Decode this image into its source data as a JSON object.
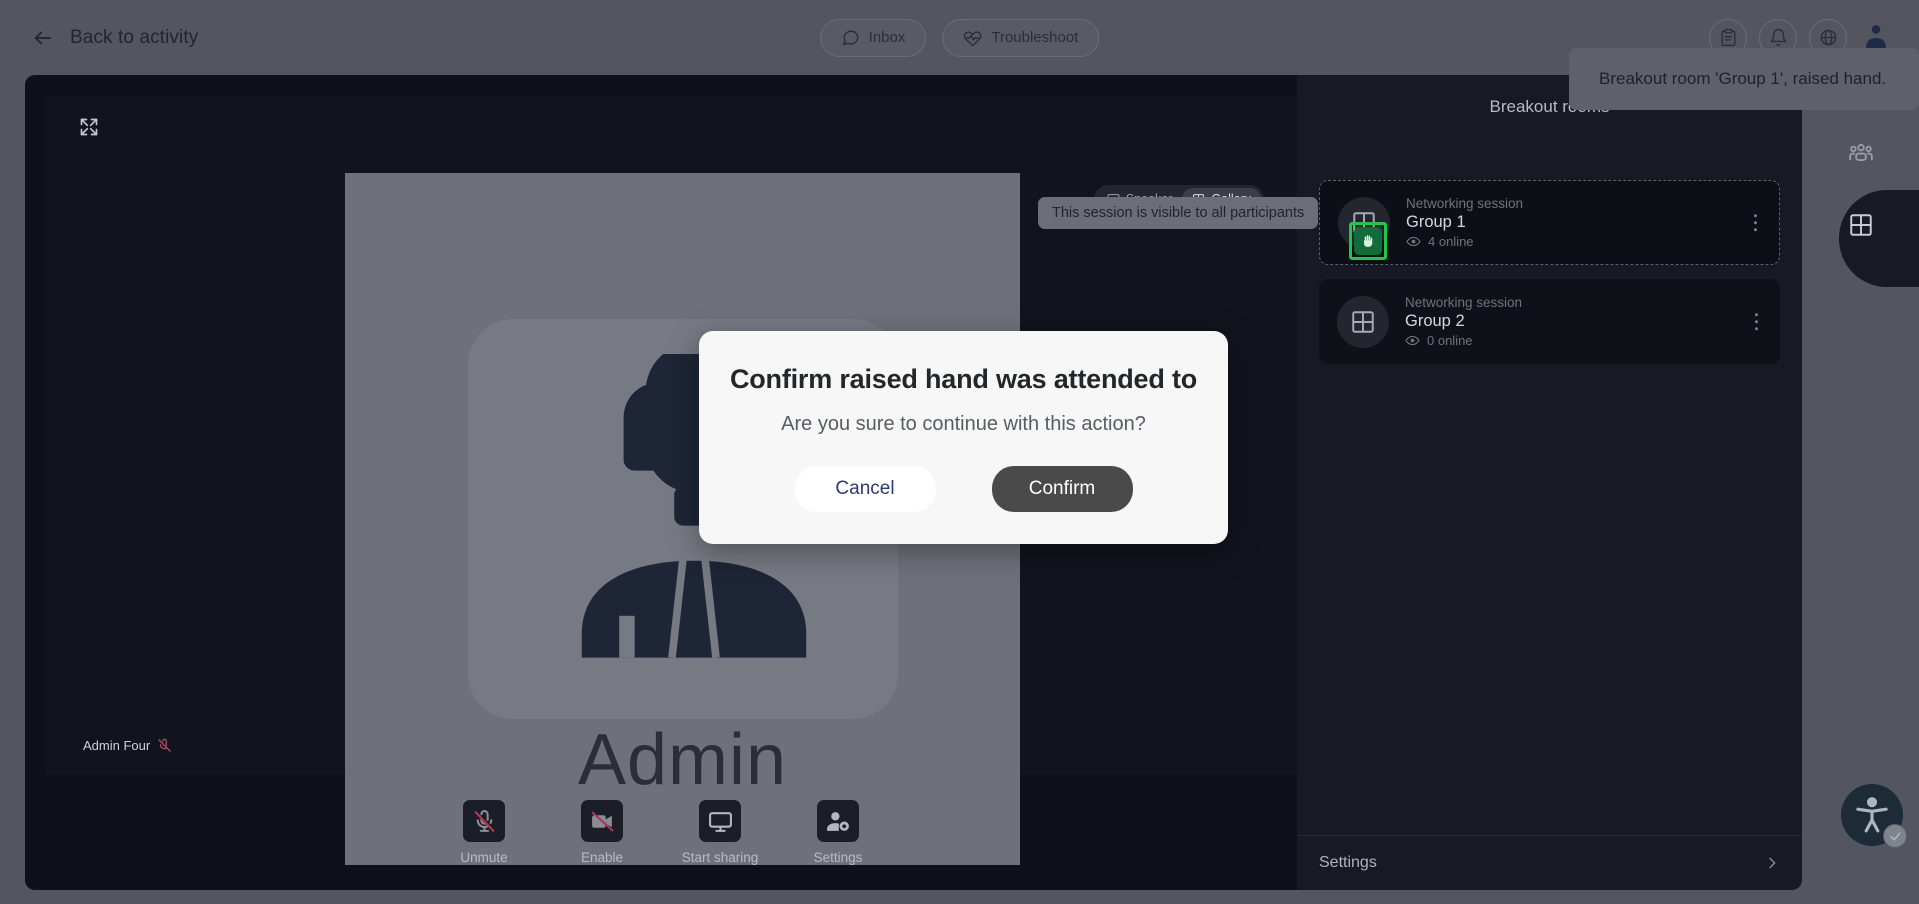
{
  "topbar": {
    "back_label": "Back to activity",
    "back_icon": "arrow-left-icon",
    "pills": [
      {
        "label": "Inbox",
        "icon": "chat-bubble-icon"
      },
      {
        "label": "Troubleshoot",
        "icon": "heartbeat-icon"
      }
    ],
    "icons": [
      {
        "name": "clipboard-icon"
      },
      {
        "name": "bell-icon"
      },
      {
        "name": "globe-icon"
      }
    ],
    "avatar": {
      "name": "user-avatar"
    }
  },
  "stage": {
    "expand_icon": "fullscreen-expand-icon",
    "view_toggle": {
      "options": [
        {
          "label": "Speaker",
          "icon": "monitor-icon",
          "active": false
        },
        {
          "label": "Gallery",
          "icon": "grid-icon",
          "active": true
        }
      ]
    },
    "tile": {
      "avatar_alt": "Admin",
      "admin_word": "Admin",
      "participant_name": "Admin Four",
      "mic_state_icon": "mic-off-icon"
    },
    "toolbar": [
      {
        "label": "Unmute",
        "icon": "mic-off-icon"
      },
      {
        "label": "Enable",
        "icon": "video-off-icon"
      },
      {
        "label": "Start sharing",
        "icon": "monitor-icon"
      },
      {
        "label": "Settings",
        "icon": "person-gear-icon"
      }
    ]
  },
  "panel": {
    "title": "Breakout rooms",
    "rooms": [
      {
        "subtitle": "Networking session",
        "name": "Group 1",
        "online": "4 online",
        "online_icon": "eye-icon",
        "room_icon": "grid-icon",
        "kebab_icon": "more-vertical-icon",
        "raised_hand": true,
        "raised_hand_icon": "raised-hand-icon",
        "highlighted": true
      },
      {
        "subtitle": "Networking session",
        "name": "Group 2",
        "online": "0 online",
        "online_icon": "eye-icon",
        "room_icon": "grid-icon",
        "kebab_icon": "more-vertical-icon",
        "raised_hand": false,
        "highlighted": false
      }
    ],
    "footer": {
      "label": "Settings",
      "icon": "chevron-right-icon"
    }
  },
  "rail": [
    {
      "name": "participants-icon",
      "active": false
    },
    {
      "name": "grid-rooms-icon",
      "active": true
    }
  ],
  "tooltip": {
    "text": "This session is visible to all participants"
  },
  "toast": {
    "text": "Breakout room 'Group 1', raised hand."
  },
  "modal": {
    "title": "Confirm raised hand was attended to",
    "subtitle": "Are you sure to continue with this action?",
    "cancel_label": "Cancel",
    "confirm_label": "Confirm"
  },
  "accessibility": {
    "icon": "accessibility-person-icon",
    "badge_icon": "check-icon"
  },
  "colors": {
    "page_bg": "#53555f",
    "stage_bg": "#0f111a",
    "panel_bg": "#171a24",
    "accent_green": "#1ec64a",
    "confirm_btn": "#4a4a4a",
    "cancel_text": "#2b3a77",
    "gear_blue": "#3d7fa6"
  }
}
